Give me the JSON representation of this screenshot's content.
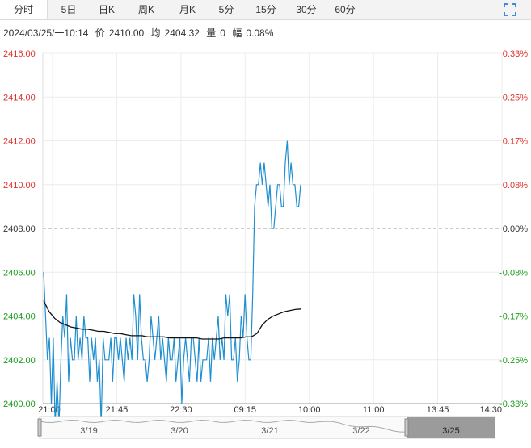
{
  "tabs": [
    {
      "label": "分时",
      "active": true
    },
    {
      "label": "5日"
    },
    {
      "label": "日K"
    },
    {
      "label": "周K"
    },
    {
      "label": "月K"
    },
    {
      "label": "5分"
    },
    {
      "label": "15分"
    },
    {
      "label": "30分"
    },
    {
      "label": "60分"
    }
  ],
  "info": {
    "datetime": "2024/03/25/一10:14",
    "price_label": "价",
    "price": "2410.00",
    "avg_label": "均",
    "avg": "2404.32",
    "volume_label": "量",
    "volume": "0",
    "change_label": "幅",
    "change": "0.08%"
  },
  "icons": {
    "expand": "expand-icon"
  },
  "colors": {
    "up": "#e0302c",
    "down": "#1a9a1a",
    "price_line": "#1f8fd0",
    "avg_line": "#111111",
    "baseline": "#999999"
  },
  "chart_data": {
    "type": "line",
    "ylim": [
      2400,
      2416
    ],
    "baseline": 2408,
    "y_ticks": [
      "2416.00",
      "2414.00",
      "2412.00",
      "2410.00",
      "2408.00",
      "2406.00",
      "2404.00",
      "2402.00",
      "2400.00"
    ],
    "pct_ticks": [
      "0.33%",
      "0.25%",
      "0.17%",
      "0.08%",
      "0.00%",
      "-0.08%",
      "-0.17%",
      "-0.25%",
      "-0.33%"
    ],
    "x_ticks": [
      "21:00",
      "21:45",
      "22:30",
      "09:15",
      "10:00",
      "11:00",
      "13:45",
      "14:30"
    ],
    "navigator_dates": [
      "3/19",
      "3/20",
      "3/21",
      "3/22",
      "3/25"
    ],
    "series": [
      {
        "role": "price",
        "values": [
          2406,
          2404,
          2402,
          2403,
          2400,
          2403,
          2399,
          2401,
          2399,
          2402,
          2404,
          2403,
          2405,
          2401,
          2403,
          2402,
          2402,
          2404,
          2402,
          2403,
          2402,
          2404,
          2403,
          2403,
          2401,
          2403,
          2402,
          2403,
          2401,
          2402,
          2399,
          2403,
          2402,
          2402,
          2402,
          2403,
          2401,
          2403,
          2403,
          2402,
          2403,
          2402,
          2401,
          2403,
          2402,
          2403,
          2402,
          2405,
          2404,
          2402,
          2405,
          2403,
          2402,
          2402,
          2401,
          2402,
          2404,
          2403,
          2402,
          2403,
          2404,
          2402,
          2403,
          2402,
          2401,
          2403,
          2402,
          2402,
          2403,
          2401,
          2402,
          2403,
          2400,
          2402,
          2403,
          2402,
          2401,
          2403,
          2403,
          2402,
          2401,
          2403,
          2401,
          2402,
          2402,
          2402,
          2403,
          2401,
          2403,
          2402,
          2403,
          2404,
          2402,
          2403,
          2402,
          2405,
          2404,
          2405,
          2402,
          2402,
          2403,
          2401,
          2402,
          2404,
          2403,
          2405,
          2403,
          2402,
          2402,
          2405,
          2409,
          2410,
          2410,
          2411,
          2410,
          2411,
          2410,
          2409,
          2410,
          2408,
          2408,
          2409,
          2410,
          2410,
          2409,
          2409,
          2411,
          2412,
          2410,
          2411,
          2410,
          2410,
          2409,
          2409,
          2410
        ]
      },
      {
        "role": "average",
        "values": [
          2404.7,
          2404.2,
          2403.9,
          2403.7,
          2403.6,
          2403.5,
          2403.45,
          2403.4,
          2403.4,
          2403.35,
          2403.3,
          2403.3,
          2403.25,
          2403.2,
          2403.2,
          2403.15,
          2403.1,
          2403.1,
          2403.1,
          2403.05,
          2403.05,
          2403.05,
          2403.05,
          2403.0,
          2403.0,
          2403.0,
          2403.0,
          2403.0,
          2403.0,
          2402.95,
          2402.95,
          2402.95,
          2402.95,
          2403.0,
          2403.0,
          2403.0,
          2403.0,
          2403.05,
          2403.05,
          2403.2,
          2403.6,
          2403.85,
          2404.0,
          2404.1,
          2404.2,
          2404.25,
          2404.3,
          2404.32
        ]
      }
    ]
  }
}
